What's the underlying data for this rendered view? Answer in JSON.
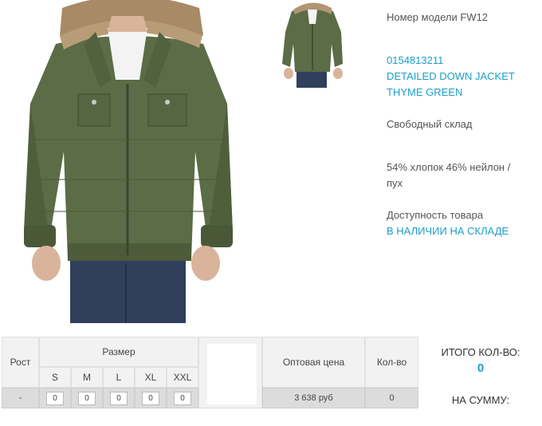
{
  "product": {
    "model_line": "Номер модели FW12",
    "code": "0154813211",
    "name_line1": "DETAILED DOWN JACKET",
    "name_line2": "THYME GREEN",
    "warehouse": "Свободный склад",
    "material_line1": "54% хлопок 46% нейлон /",
    "material_line2": "пух",
    "availability_label": "Доступность товара",
    "availability_value": "В НАЛИЧИИ НА СКЛАДЕ"
  },
  "table": {
    "col_height": "Рост",
    "col_size": "Размер",
    "sizes": [
      "S",
      "M",
      "L",
      "XL",
      "XXL"
    ],
    "col_price": "Оптовая цена",
    "col_qty": "Кол-во",
    "row": {
      "height": "-",
      "size_qty": [
        "0",
        "0",
        "0",
        "0",
        "0"
      ],
      "price": "3 638 руб",
      "qty": "0"
    }
  },
  "totals": {
    "total_qty_label": "ИТОГО КОЛ-ВО:",
    "total_qty_value": "0",
    "total_sum_label": "НА СУММУ:"
  },
  "colors": {
    "accent": "#1a9fc9",
    "jacket": "#5a6b45",
    "fur": "#b79a76",
    "jeans": "#2d3d5a"
  }
}
